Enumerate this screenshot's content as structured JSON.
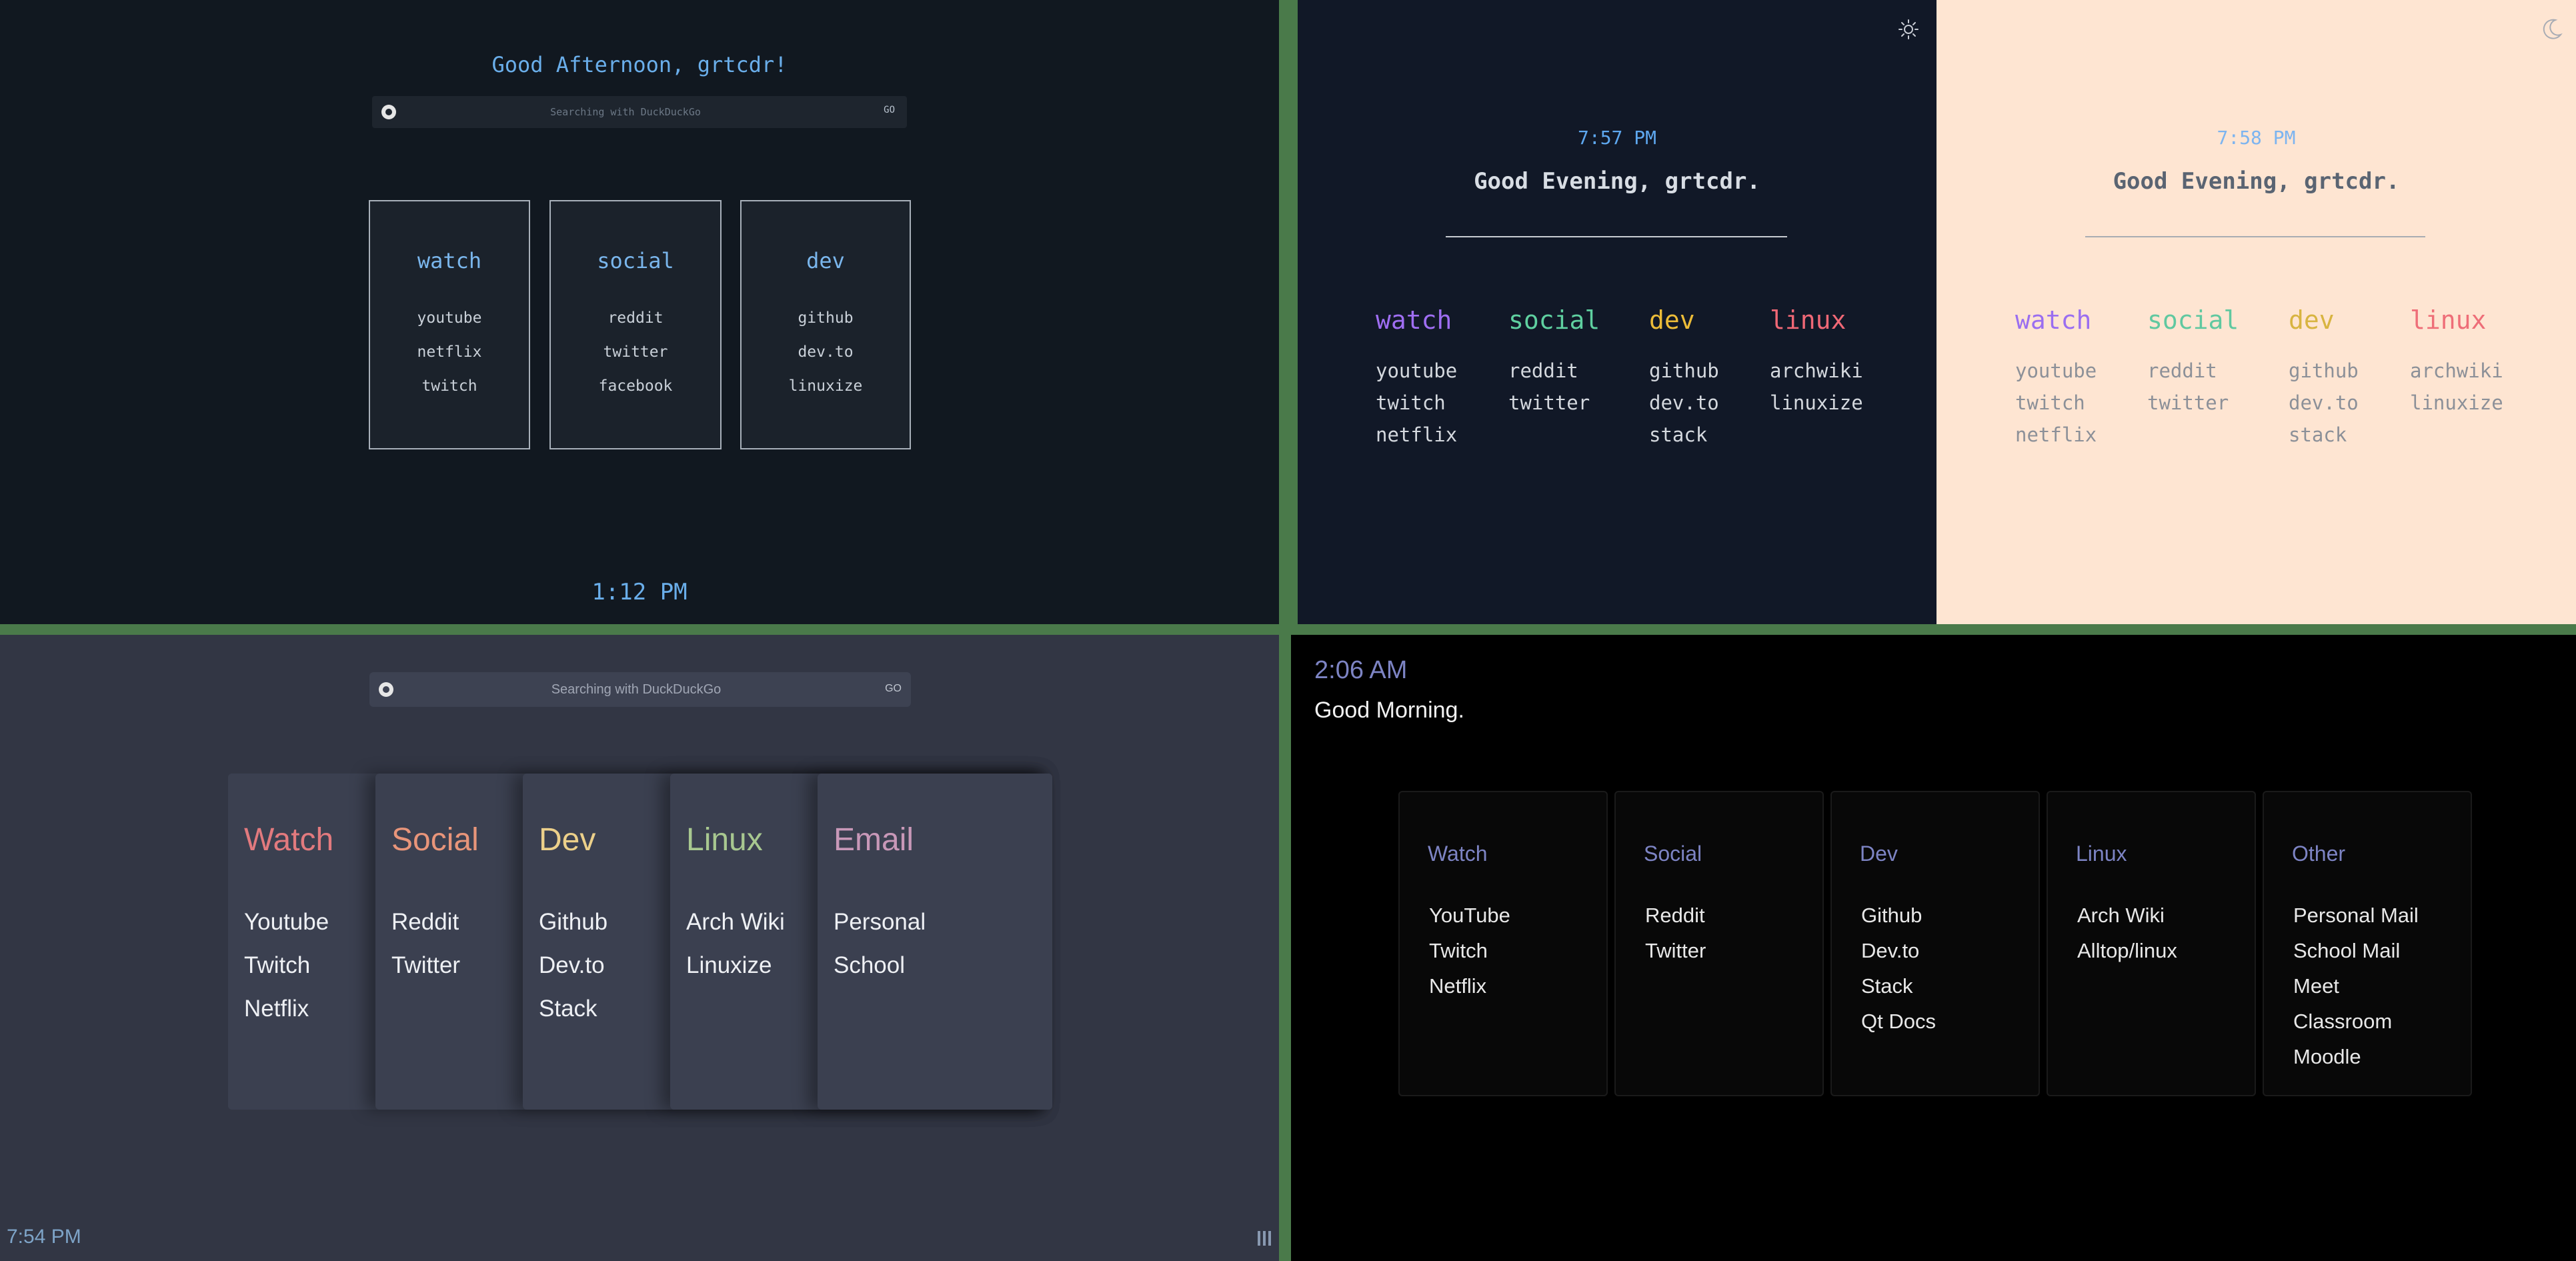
{
  "panel_a": {
    "greeting": "Good Afternoon, grtcdr!",
    "search_placeholder": "Searching with DuckDuckGo",
    "go_label": "GO",
    "cards": [
      {
        "title": "watch",
        "links": [
          "youtube",
          "netflix",
          "twitch"
        ]
      },
      {
        "title": "social",
        "links": [
          "reddit",
          "twitter",
          "facebook"
        ]
      },
      {
        "title": "dev",
        "links": [
          "github",
          "dev.to",
          "linuxize"
        ]
      }
    ],
    "clock": "1:12 PM"
  },
  "panel_b": {
    "time": "7:57 PM",
    "greeting": "Good Evening, grtcdr.",
    "theme_toggle_icon": "sun-icon",
    "columns": [
      {
        "title": "watch",
        "color": "#9f6ef2",
        "links": [
          "youtube",
          "twitch",
          "netflix"
        ]
      },
      {
        "title": "social",
        "color": "#5fd0a0",
        "links": [
          "reddit",
          "twitter"
        ]
      },
      {
        "title": "dev",
        "color": "#ecbc38",
        "links": [
          "github",
          "dev.to",
          "stack"
        ]
      },
      {
        "title": "linux",
        "color": "#f06876",
        "links": [
          "archwiki",
          "linuxize"
        ]
      }
    ]
  },
  "panel_c": {
    "time": "7:58 PM",
    "greeting": "Good Evening, grtcdr.",
    "theme_toggle_icon": "moon-icon",
    "columns": [
      {
        "title": "watch",
        "color": "#9a6ef0",
        "links": [
          "youtube",
          "twitch",
          "netflix"
        ]
      },
      {
        "title": "social",
        "color": "#60c8a0",
        "links": [
          "reddit",
          "twitter"
        ]
      },
      {
        "title": "dev",
        "color": "#d8b440",
        "links": [
          "github",
          "dev.to",
          "stack"
        ]
      },
      {
        "title": "linux",
        "color": "#ee6e78",
        "links": [
          "archwiki",
          "linuxize"
        ]
      }
    ]
  },
  "panel_d": {
    "search_placeholder": "Searching with DuckDuckGo",
    "go_label": "GO",
    "cards": [
      {
        "title": "Watch",
        "color": "#e27a7e",
        "links": [
          "Youtube",
          "Twitch",
          "Netflix"
        ]
      },
      {
        "title": "Social",
        "color": "#e8957a",
        "links": [
          "Reddit",
          "Twitter"
        ]
      },
      {
        "title": "Dev",
        "color": "#ecd08a",
        "links": [
          "Github",
          "Dev.to",
          "Stack"
        ]
      },
      {
        "title": "Linux",
        "color": "#a8c890",
        "links": [
          "Arch Wiki",
          "Linuxize"
        ]
      },
      {
        "title": "Email",
        "color": "#c898b8",
        "links": [
          "Personal",
          "School"
        ]
      }
    ],
    "clock": "7:54 PM",
    "menu_icon": "bars-icon"
  },
  "panel_e": {
    "time": "2:06 AM",
    "greeting": "Good Morning.",
    "cards": [
      {
        "title": "Watch",
        "links": [
          "YouTube",
          "Twitch",
          "Netflix"
        ]
      },
      {
        "title": "Social",
        "links": [
          "Reddit",
          "Twitter"
        ]
      },
      {
        "title": "Dev",
        "links": [
          "Github",
          "Dev.to",
          "Stack",
          "Qt Docs"
        ]
      },
      {
        "title": "Linux",
        "links": [
          "Arch Wiki",
          "Alltop/linux"
        ]
      },
      {
        "title": "Other",
        "links": [
          "Personal Mail",
          "School Mail",
          "Meet",
          "Classroom",
          "Moodle"
        ]
      }
    ]
  }
}
